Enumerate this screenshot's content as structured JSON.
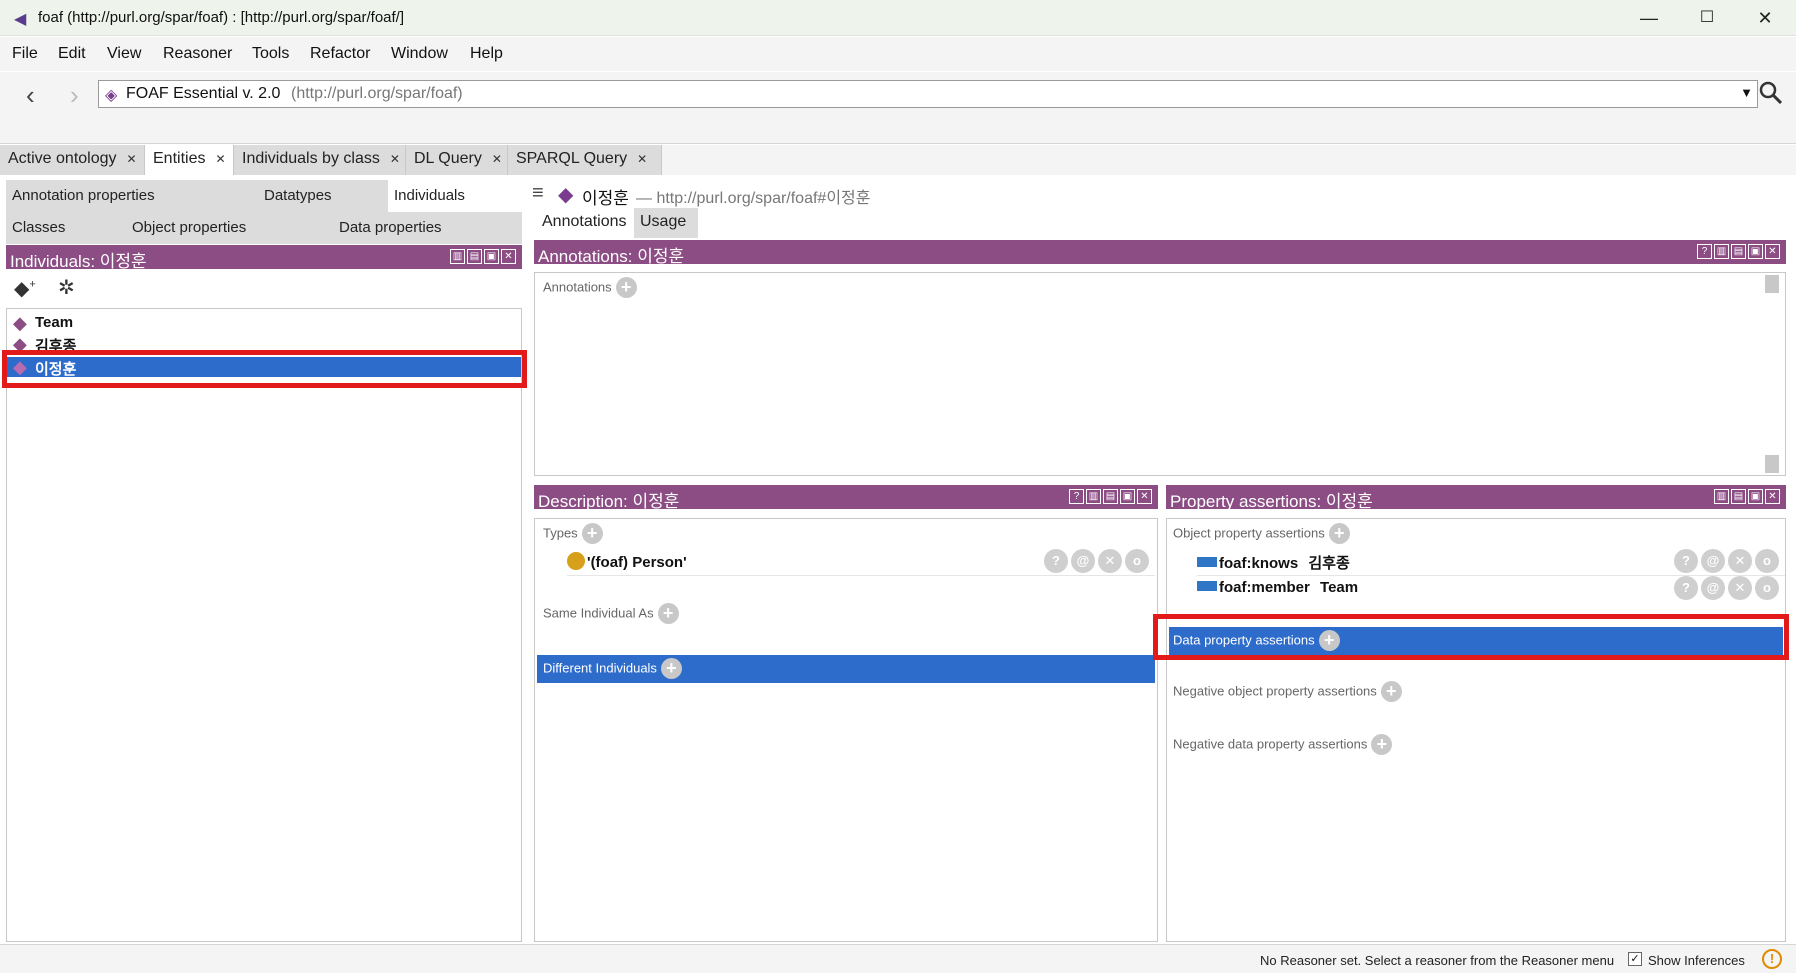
{
  "window": {
    "title": "foaf (http://purl.org/spar/foaf)  : [http://purl.org/spar/foaf/]",
    "minimize": "—",
    "maximize": "☐",
    "close": "✕"
  },
  "menu": [
    "File",
    "Edit",
    "View",
    "Reasoner",
    "Tools",
    "Refactor",
    "Window",
    "Help"
  ],
  "address": {
    "name": "FOAF Essential v. 2.0",
    "iri": "(http://purl.org/spar/foaf)"
  },
  "tabs": [
    "Active ontology",
    "Entities",
    "Individuals by class",
    "DL Query",
    "SPARQL Query"
  ],
  "subtabs": {
    "row1": [
      "Annotation properties",
      "Datatypes",
      "Individuals"
    ],
    "row2": [
      "Classes",
      "Object properties",
      "Data properties"
    ]
  },
  "individuals": {
    "header": "Individuals: 이정훈",
    "items": [
      "Team",
      "김후종",
      "이정훈"
    ]
  },
  "entity": {
    "name": "이정훈",
    "iri": "— http://purl.org/spar/foaf#이정훈"
  },
  "annotation_tabs": [
    "Annotations",
    "Usage"
  ],
  "annotations": {
    "header": "Annotations: 이정훈",
    "section": "Annotations"
  },
  "description": {
    "header": "Description: 이정훈",
    "types_label": "Types",
    "type_value": "'(foaf) Person'",
    "same_label": "Same Individual As",
    "different_label": "Different Individuals"
  },
  "property_assertions": {
    "header": "Property assertions: 이정훈",
    "object_label": "Object property assertions",
    "object_items": [
      {
        "prop": "foaf:knows",
        "value": "김후종"
      },
      {
        "prop": "foaf:member",
        "value": "Team"
      }
    ],
    "data_label": "Data property assertions",
    "neg_object_label": "Negative object property assertions",
    "neg_data_label": "Negative data property assertions"
  },
  "status": {
    "message": "No Reasoner set. Select a reasoner from the Reasoner menu",
    "show_inferences": "Show Inferences",
    "checked": true
  },
  "colors": {
    "view_header": "#8c4d84",
    "selection": "#2e6ccc",
    "highlight": "#e31a1a"
  }
}
